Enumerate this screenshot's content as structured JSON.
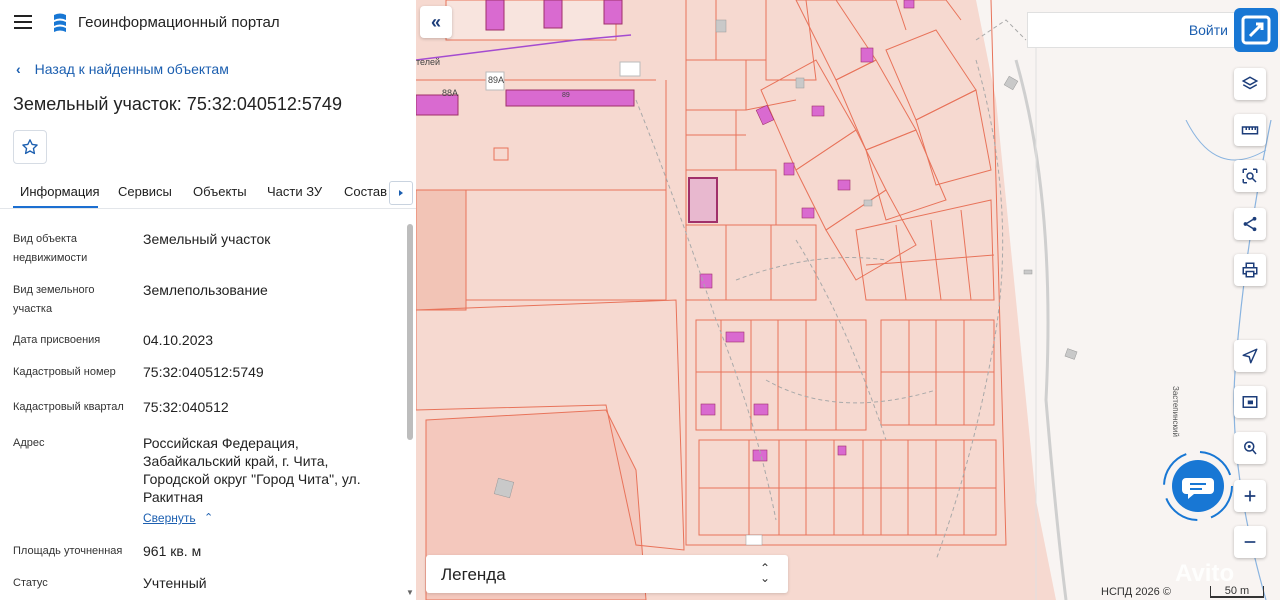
{
  "app": {
    "title": "Геоинформационный портал"
  },
  "nav": {
    "back_label": "Назад к найденным объектам"
  },
  "object": {
    "title": "Земельный участок: 75:32:040512:5749"
  },
  "tabs": [
    {
      "label": "Информация",
      "active": true
    },
    {
      "label": "Сервисы",
      "active": false
    },
    {
      "label": "Объекты",
      "active": false
    },
    {
      "label": "Части ЗУ",
      "active": false
    },
    {
      "label": "Состав",
      "active": false
    }
  ],
  "info": [
    {
      "label": "Вид объекта недвижимости",
      "value": "Земельный участок"
    },
    {
      "label": "Вид земельного участка",
      "value": "Землепользование"
    },
    {
      "label": "Дата присвоения",
      "value": "04.10.2023"
    },
    {
      "label": "Кадастровый номер",
      "value": "75:32:040512:5749"
    },
    {
      "label": "Кадастровый квартал",
      "value": "75:32:040512"
    },
    {
      "label": "Адрес",
      "value": "Российская Федерация, Забайкальский край, г. Чита, Городской округ \"Город Чита\", ул. Ракитная"
    },
    {
      "label": "Площадь уточненная",
      "value": "961 кв. м"
    },
    {
      "label": "Статус",
      "value": "Учтенный"
    }
  ],
  "address_toggle": "Свернуть",
  "map": {
    "search_button": "Войти",
    "legend_label": "Легенда",
    "copyright": "НСПД 2026 ©",
    "scale": "50 m",
    "street_labels": [
      "телей",
      "89А",
      "88А",
      "89",
      "Застепинский"
    ],
    "watermark": "Avito",
    "colors": {
      "background": "#f6d9d0",
      "parcel_border": "#e8735a",
      "building": "#d96ad0",
      "selected": "#a0306a",
      "accent": "#1877d4"
    }
  },
  "toolbar": [
    {
      "icon": "layers-icon"
    },
    {
      "icon": "ruler-icon"
    },
    {
      "icon": "search-area-icon"
    },
    {
      "icon": "share-icon"
    },
    {
      "icon": "print-icon"
    },
    {
      "icon": "locate-icon"
    },
    {
      "icon": "minimap-icon"
    },
    {
      "icon": "geo-pin-icon"
    },
    {
      "icon": "zoom-in-icon"
    },
    {
      "icon": "zoom-out-icon"
    }
  ]
}
